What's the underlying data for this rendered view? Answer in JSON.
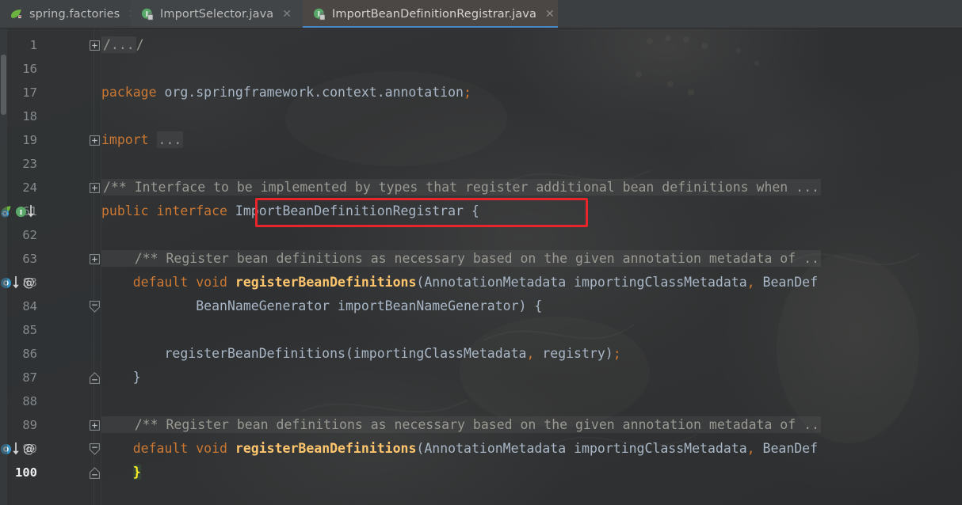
{
  "window": {
    "theme": "darcula",
    "accent_blue": "#4a88c7",
    "annotation_color": "#e8252a"
  },
  "tabs": [
    {
      "label": "spring.factories",
      "icon": "spring-leaf-icon",
      "active": false,
      "close": "✕"
    },
    {
      "label": "ImportSelector.java",
      "icon": "java-interface-icon",
      "active": false,
      "close": "✕"
    },
    {
      "label": "ImportBeanDefinitionRegistrar.java",
      "icon": "java-interface-icon",
      "active": true,
      "close": "✕"
    }
  ],
  "editor": {
    "current_line": "100",
    "lines": [
      {
        "num": "1",
        "fold": "collapsed",
        "gutter_icons": [],
        "segments": [
          {
            "t": "/...",
            "c": "fold-ph foldbg"
          },
          {
            "t": "/",
            "c": "cmt"
          }
        ]
      },
      {
        "num": "16",
        "fold": "none",
        "gutter_icons": [],
        "segments": []
      },
      {
        "num": "17",
        "fold": "none",
        "gutter_icons": [],
        "segments": [
          {
            "t": "package",
            "c": "kw"
          },
          {
            "t": " ",
            "c": "punc"
          },
          {
            "t": "org.springframework.context.annotation",
            "c": "ident"
          },
          {
            "t": ";",
            "c": "semi"
          }
        ]
      },
      {
        "num": "18",
        "fold": "none",
        "gutter_icons": [],
        "segments": []
      },
      {
        "num": "19",
        "fold": "collapsed",
        "gutter_icons": [],
        "segments": [
          {
            "t": "import",
            "c": "kw"
          },
          {
            "t": " ",
            "c": "punc"
          },
          {
            "t": "...",
            "c": "fold-ph foldbg"
          }
        ]
      },
      {
        "num": "23",
        "fold": "none",
        "gutter_icons": [],
        "segments": []
      },
      {
        "num": "24",
        "fold": "collapsed",
        "gutter_icons": [],
        "segments": [
          {
            "t": "/** Interface to be implemented by types that register additional bean definitions when ...",
            "c": "cmt foldbg"
          }
        ]
      },
      {
        "num": "61",
        "fold": "none",
        "gutter_icons": [
          "spring-bean-icon",
          "java-interface-icon",
          "implemented-by-arrow-icon"
        ],
        "segments": [
          {
            "t": "public",
            "c": "kw"
          },
          {
            "t": " ",
            "c": "punc"
          },
          {
            "t": "interface",
            "c": "kw"
          },
          {
            "t": " ",
            "c": "punc"
          },
          {
            "t": "ImportBeanDefinitionRegistrar",
            "c": "type"
          },
          {
            "t": " {",
            "c": "punc"
          }
        ]
      },
      {
        "num": "62",
        "fold": "none",
        "gutter_icons": [],
        "segments": []
      },
      {
        "num": "63",
        "fold": "collapsed",
        "gutter_icons": [],
        "segments": [
          {
            "t": "    /** Register bean definitions as necessary based on the given annotation metadata of ..",
            "c": "cmt foldbg"
          }
        ]
      },
      {
        "num": "83",
        "fold": "none",
        "gutter_icons": [
          "overridden-method-icon",
          "implemented-by-arrow-icon",
          "annotation-at-icon"
        ],
        "segments": [
          {
            "t": "    ",
            "c": "punc"
          },
          {
            "t": "default",
            "c": "kw"
          },
          {
            "t": " ",
            "c": "punc"
          },
          {
            "t": "void",
            "c": "kw"
          },
          {
            "t": " ",
            "c": "punc"
          },
          {
            "t": "registerBeanDefinitions",
            "c": "mth"
          },
          {
            "t": "(",
            "c": "punc"
          },
          {
            "t": "AnnotationMetadata",
            "c": "type"
          },
          {
            "t": " importingClassMetadata",
            "c": "ident"
          },
          {
            "t": ",",
            "c": "comma"
          },
          {
            "t": " BeanDef",
            "c": "type"
          }
        ]
      },
      {
        "num": "84",
        "fold": "expanded-end",
        "gutter_icons": [],
        "segments": [
          {
            "t": "            ",
            "c": "punc"
          },
          {
            "t": "BeanNameGenerator",
            "c": "type"
          },
          {
            "t": " importBeanNameGenerator",
            "c": "ident"
          },
          {
            "t": ")",
            "c": "punc"
          },
          {
            "t": " {",
            "c": "punc"
          }
        ]
      },
      {
        "num": "85",
        "fold": "none",
        "gutter_icons": [],
        "segments": []
      },
      {
        "num": "86",
        "fold": "none",
        "gutter_icons": [],
        "segments": [
          {
            "t": "        ",
            "c": "punc"
          },
          {
            "t": "registerBeanDefinitions",
            "c": "mthcall"
          },
          {
            "t": "(",
            "c": "punc"
          },
          {
            "t": "importingClassMetadata",
            "c": "ident"
          },
          {
            "t": ",",
            "c": "comma"
          },
          {
            "t": " registry",
            "c": "ident"
          },
          {
            "t": ")",
            "c": "punc"
          },
          {
            "t": ";",
            "c": "semi"
          }
        ]
      },
      {
        "num": "87",
        "fold": "block-end",
        "gutter_icons": [],
        "segments": [
          {
            "t": "    }",
            "c": "punc"
          }
        ]
      },
      {
        "num": "88",
        "fold": "none",
        "gutter_icons": [],
        "segments": []
      },
      {
        "num": "89",
        "fold": "collapsed",
        "gutter_icons": [],
        "segments": [
          {
            "t": "    /** Register bean definitions as necessary based on the given annotation metadata of ..",
            "c": "cmt foldbg"
          }
        ]
      },
      {
        "num": "99",
        "fold": "expanded-end",
        "gutter_icons": [
          "overridden-method-icon",
          "implemented-by-arrow-icon",
          "annotation-at-icon"
        ],
        "segments": [
          {
            "t": "    ",
            "c": "punc"
          },
          {
            "t": "default",
            "c": "kw"
          },
          {
            "t": " ",
            "c": "punc"
          },
          {
            "t": "void",
            "c": "kw"
          },
          {
            "t": " ",
            "c": "punc"
          },
          {
            "t": "registerBeanDefinitions",
            "c": "mth"
          },
          {
            "t": "(",
            "c": "punc"
          },
          {
            "t": "AnnotationMetadata",
            "c": "type"
          },
          {
            "t": " importingClassMetadata",
            "c": "ident"
          },
          {
            "t": ",",
            "c": "comma"
          },
          {
            "t": " BeanDef",
            "c": "type"
          }
        ]
      },
      {
        "num": "100",
        "fold": "block-end",
        "gutter_icons": [],
        "current": true,
        "segments": [
          {
            "t": "    ",
            "c": "punc"
          },
          {
            "t": "}",
            "c": "brace-hl"
          }
        ]
      }
    ]
  },
  "annotation": {
    "type": "red-rectangle-highlight",
    "target_text": "ImportBeanDefinitionRegistrar {"
  }
}
